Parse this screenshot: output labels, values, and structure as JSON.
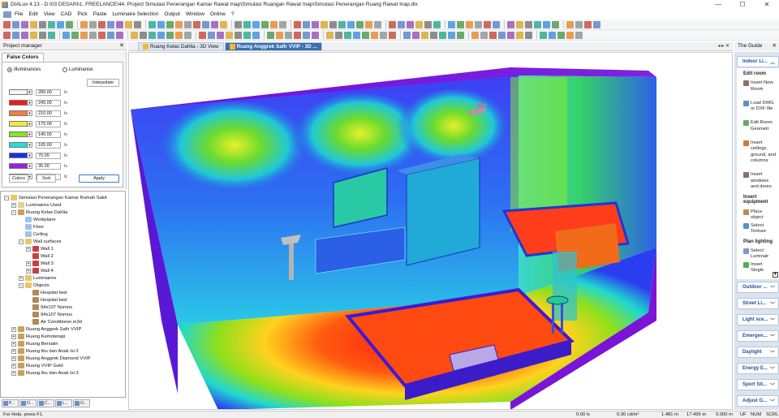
{
  "window": {
    "title": "DIALux 4.13 - D:\\03 DESAIN\\1. FREELANCE\\44. Project Simulasi Penerangan Kamar  Rawat Inap\\Simulasi Ruangan Rawat Inap\\Simulasi Penerangan Ruang Rawat Inap.dlx",
    "minimize": "—",
    "maximize": "☐",
    "close": "✕"
  },
  "menu": [
    "",
    "File",
    "Edit",
    "View",
    "CAD",
    "Pick",
    "Paste",
    "Luminaire Selection",
    "Output",
    "Window",
    "Online",
    "?"
  ],
  "project_manager": {
    "title": "Project manager",
    "close": "✕",
    "tab": "False Colors",
    "radio_illuminances": "Illuminances",
    "radio_luminance": "Luminance",
    "interpolate": "Interpolate",
    "rows": [
      {
        "color": "#f6f6ee",
        "value": "280.00",
        "unit": "lx"
      },
      {
        "color": "#ee1c1c",
        "value": "245.00",
        "unit": "lx"
      },
      {
        "color": "#f08040",
        "value": "210.00",
        "unit": "lx"
      },
      {
        "color": "#f4ea3e",
        "value": "175.00",
        "unit": "lx"
      },
      {
        "color": "#8fe023",
        "value": "140.00",
        "unit": "lx"
      },
      {
        "color": "#24dcda",
        "value": "105.00",
        "unit": "lx"
      },
      {
        "color": "#1a2fe8",
        "value": "70.00",
        "unit": "lx"
      },
      {
        "color": "#9b1ee0",
        "value": "35.00",
        "unit": "lx"
      },
      {
        "color": "#000000",
        "value": "0.00",
        "unit": "lx"
      }
    ],
    "btn_colors": "Colors",
    "btn_sort": "Sort",
    "btn_apply": "Apply"
  },
  "tree": [
    {
      "label": "Simulasi Penerangan Kamar Rumah Sakit",
      "level": 0,
      "exp": "−",
      "icon": "folder"
    },
    {
      "label": "Luminaires Used",
      "level": 1,
      "exp": "+",
      "icon": "lum"
    },
    {
      "label": "Ruang Kelas Dahlia",
      "level": 1,
      "exp": "−",
      "icon": "room"
    },
    {
      "label": "Workplane",
      "level": 2,
      "exp": "",
      "icon": "plane"
    },
    {
      "label": "Floor",
      "level": 2,
      "exp": "",
      "icon": "plane"
    },
    {
      "label": "Ceiling",
      "level": 2,
      "exp": "",
      "icon": "plane"
    },
    {
      "label": "Wall surfaces",
      "level": 2,
      "exp": "−",
      "icon": "folder"
    },
    {
      "label": "Wall 1",
      "level": 3,
      "exp": "+",
      "icon": "wall"
    },
    {
      "label": "Wall 2",
      "level": 3,
      "exp": "",
      "icon": "wall"
    },
    {
      "label": "Wall 3",
      "level": 3,
      "exp": "+",
      "icon": "wall"
    },
    {
      "label": "Wall 4",
      "level": 3,
      "exp": "+",
      "icon": "wall"
    },
    {
      "label": "Luminaires",
      "level": 2,
      "exp": "+",
      "icon": "folder"
    },
    {
      "label": "Objects",
      "level": 2,
      "exp": "−",
      "icon": "folder"
    },
    {
      "label": "Hospital bed",
      "level": 3,
      "exp": "",
      "icon": "obj"
    },
    {
      "label": "Hospital bed",
      "level": 3,
      "exp": "",
      "icon": "obj"
    },
    {
      "label": "94x107 Nomos",
      "level": 3,
      "exp": "",
      "icon": "obj"
    },
    {
      "label": "94x107 Nomos",
      "level": 3,
      "exp": "",
      "icon": "obj"
    },
    {
      "label": "Air Conditioner.m3d",
      "level": 3,
      "exp": "",
      "icon": "obj"
    },
    {
      "label": "Ruang Anggrek Safir VVIP",
      "level": 1,
      "exp": "+",
      "icon": "room"
    },
    {
      "label": "Ruang Kemoterapi",
      "level": 1,
      "exp": "+",
      "icon": "room"
    },
    {
      "label": "Ruang Bersalin",
      "level": 1,
      "exp": "+",
      "icon": "room"
    },
    {
      "label": "Ruang Ibu dan Anak Isi 2",
      "level": 1,
      "exp": "+",
      "icon": "room"
    },
    {
      "label": "Ruang Anggrek Diamond VVIP",
      "level": 1,
      "exp": "+",
      "icon": "room"
    },
    {
      "label": "Ruang VVIP Gold",
      "level": 1,
      "exp": "+",
      "icon": "room"
    },
    {
      "label": "Ruang Ibu dan Anak Isi 3",
      "level": 1,
      "exp": "+",
      "icon": "room"
    }
  ],
  "bottom_tabs": [
    "P...",
    "O...",
    "C...",
    "L...",
    "O..."
  ],
  "view_tabs": [
    {
      "label": "Ruang Kelas Dahlia - 3D View",
      "active": false
    },
    {
      "label": "Ruang Anggrek Safir VVIP - 3D ...",
      "active": true
    }
  ],
  "view_controls": "◂ ▸ ✕",
  "guide": {
    "title": "The Guide",
    "close": "✕",
    "top_section": "Indoor Li...",
    "edit_room": "Edit room",
    "edit_items": [
      "Insert New Room",
      "Load DWG or DXF file",
      "Edit Room Geometr",
      "Insert ceilings, ground, and columns",
      "Insert windows and doors"
    ],
    "insert_equipment": "Insert equipment",
    "equipment_items": [
      "Place object",
      "Select Texture"
    ],
    "plan_lighting": "Plan lighting",
    "lighting_items": [
      "Select Luminair",
      "Insert Single"
    ],
    "sections": [
      "Outdoor ...",
      "Street Li...",
      "Light sce...",
      "Emergen...",
      "Daylight",
      "Energy E...",
      "Sport Sit...",
      "Adjust G..."
    ]
  },
  "status": {
    "help": "For Help, press F1.",
    "lx": "0.00 lx",
    "cd": "0.00 cd/m²",
    "m1": "1.481 m",
    "m2": "17.495 m",
    "m3": "0.000 m",
    "uf": "UF",
    "num": "NUM",
    "scrl": "SCRL"
  }
}
